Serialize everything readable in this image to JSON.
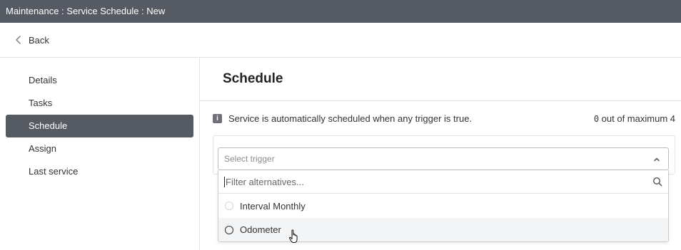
{
  "titlebar": {
    "title": "Maintenance : Service Schedule : New"
  },
  "backbar": {
    "label": "Back",
    "icon": "chevron-left-icon"
  },
  "sidebar": {
    "items": [
      {
        "label": "Details",
        "active": false
      },
      {
        "label": "Tasks",
        "active": false
      },
      {
        "label": "Schedule",
        "active": true
      },
      {
        "label": "Assign",
        "active": false
      },
      {
        "label": "Last service",
        "active": false
      }
    ]
  },
  "main": {
    "title": "Schedule",
    "info": {
      "icon": "info-icon",
      "text": "Service is automatically scheduled when any trigger is true.",
      "counter_count": "0",
      "counter_suffix": "out of maximum 4"
    },
    "trigger_select": {
      "placeholder": "Select trigger",
      "caret_icon": "chevron-up-icon"
    },
    "dropdown": {
      "filter_placeholder": "Filter alternatives...",
      "search_icon": "search-icon",
      "options": [
        {
          "label": "Interval Monthly",
          "disabled": true
        },
        {
          "label": "Odometer",
          "hovered": true
        }
      ]
    }
  },
  "colors": {
    "titlebar_bg": "#565a63",
    "active_nav_bg": "#565a63",
    "option_hover_bg": "#f3f4f6"
  }
}
